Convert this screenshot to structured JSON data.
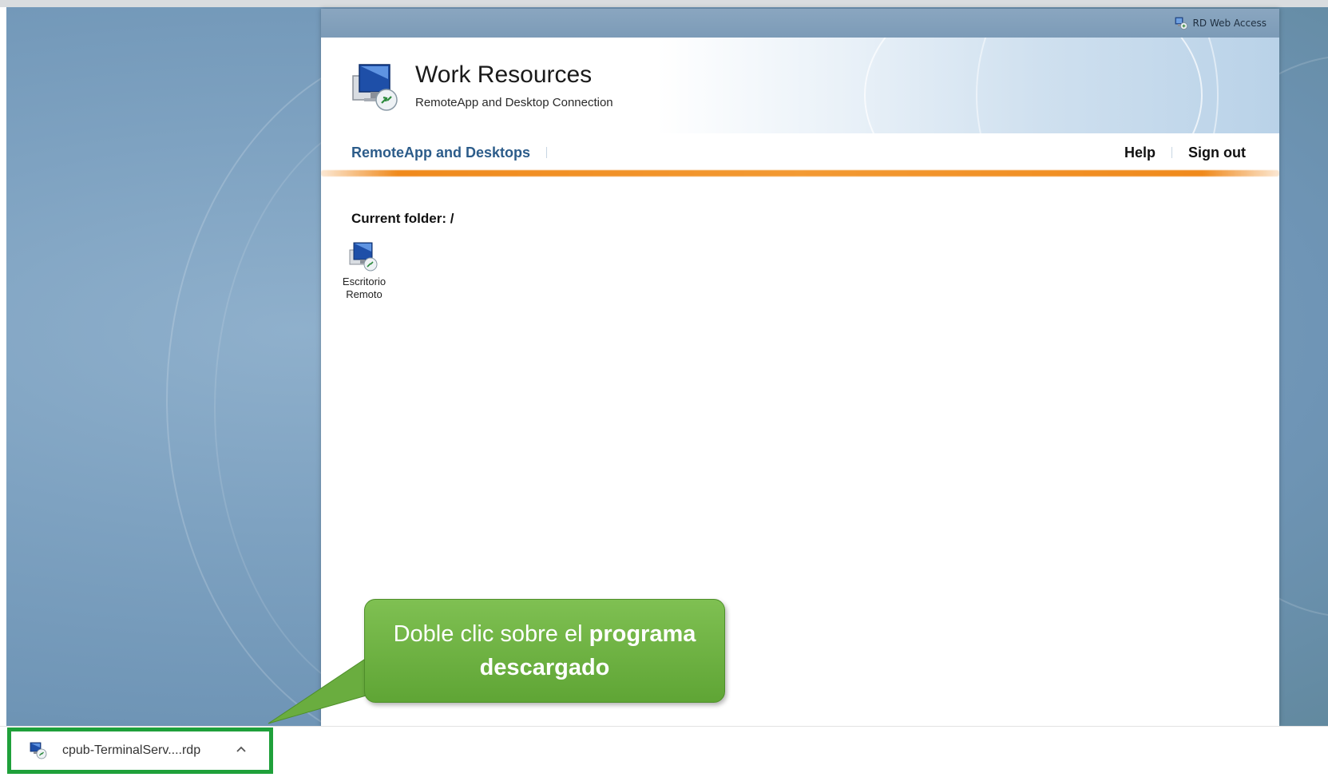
{
  "header": {
    "rd_web_access_label": "RD Web Access",
    "title": "Work Resources",
    "subtitle": "RemoteApp and Desktop Connection"
  },
  "nav": {
    "tab_label": "RemoteApp and Desktops",
    "help_label": "Help",
    "sign_out_label": "Sign out"
  },
  "content": {
    "current_folder_label": "Current folder: /",
    "apps": [
      {
        "label_line1": "Escritorio",
        "label_line2": "Remoto",
        "icon": "remote-desktop-icon"
      }
    ]
  },
  "callout": {
    "text_plain": "Doble clic sobre el ",
    "text_bold_1": "programa",
    "text_bold_2": "descargado"
  },
  "download_bar": {
    "file_name": "cpub-TerminalServ....rdp",
    "file_icon": "rdp-file-icon",
    "chevron_icon": "chevron-up-icon"
  },
  "colors": {
    "nav_tab": "#2c5c8a",
    "accent_orange": "#f08a1c",
    "callout_green": "#6aad3f",
    "highlight_border": "#1fa03a",
    "backdrop_blue": "#7ea2c1"
  }
}
